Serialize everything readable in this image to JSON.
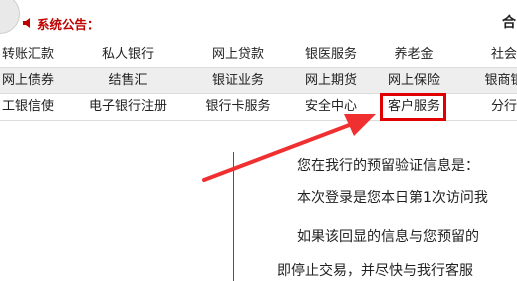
{
  "announcement": {
    "label": "系统公告：",
    "icon": "speaker-icon"
  },
  "header": {
    "edge_char": "合"
  },
  "nav": {
    "row1": [
      "转账汇款",
      "私人银行",
      "网上贷款",
      "银医服务",
      "养老金",
      "社会"
    ],
    "row2": [
      "网上债券",
      "结售汇",
      "银证业务",
      "网上期货",
      "网上保险",
      "银商银"
    ],
    "row3": [
      "工银信使",
      "电子银行注册",
      "银行卡服务",
      "安全中心",
      "客户服务",
      "分行"
    ]
  },
  "content": {
    "lines": [
      "您在我行的预留验证信息是：",
      "本次登录是您本日第1次访问我",
      "如果该回显的信息与您预留的",
      "即停止交易，并尽快与我行客服"
    ]
  },
  "colors": {
    "accent_red": "#e00000",
    "announce_red": "#c00000",
    "row_gray": "#eeeeee"
  },
  "highlighted_item": "客户服务"
}
